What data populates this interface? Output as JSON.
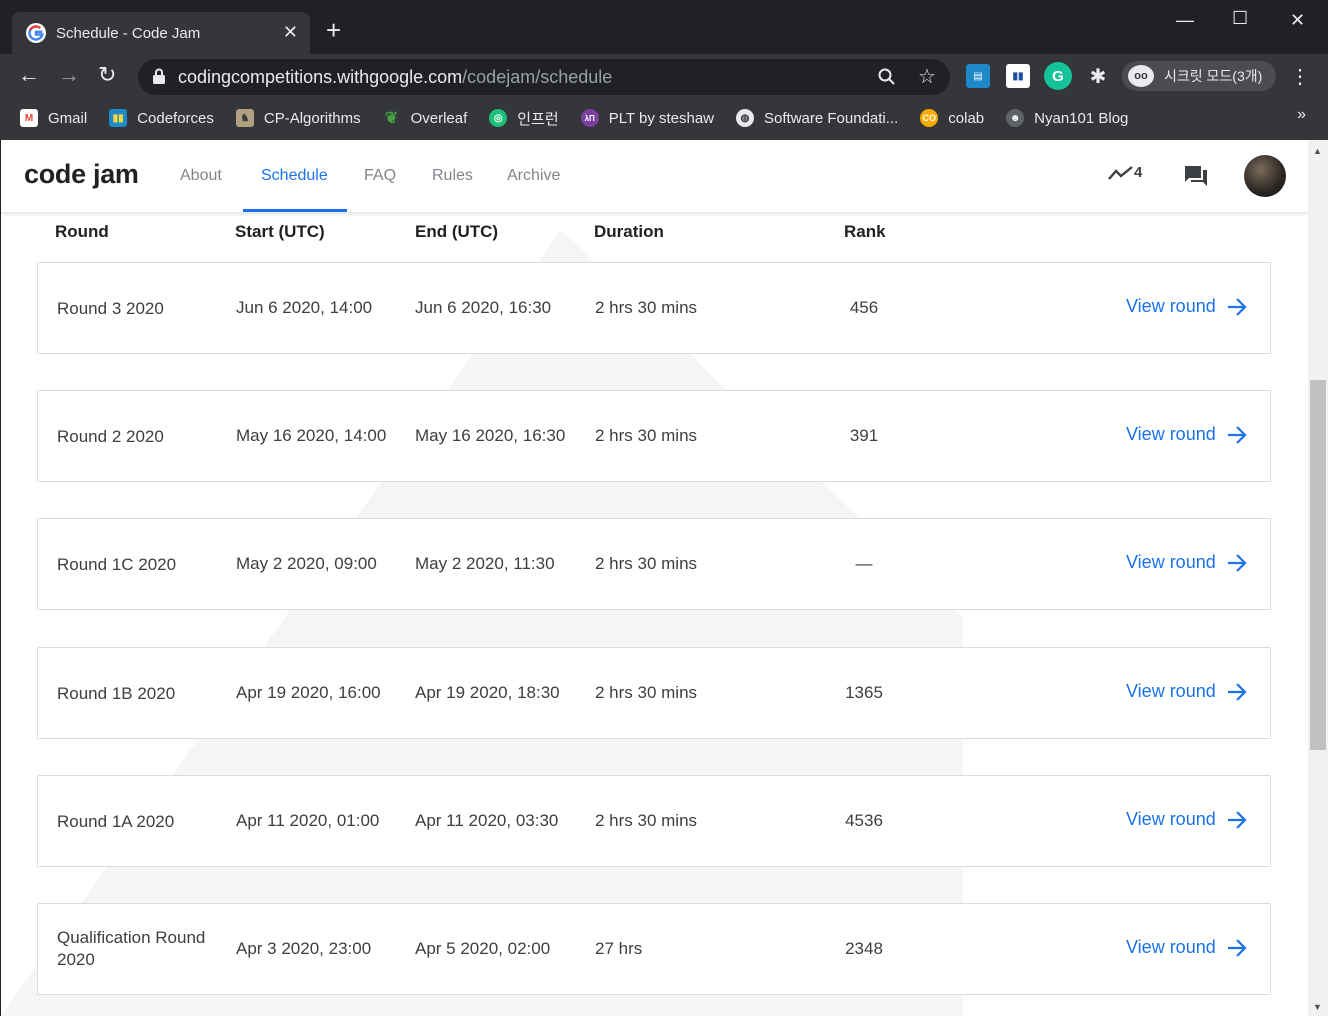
{
  "browser": {
    "tab_title": "Schedule - Code Jam",
    "new_tab": "+",
    "url_host": "codingcompetitions.withgoogle.com",
    "url_path": "/codejam/schedule",
    "incognito_label": "시크릿 모드(3개)",
    "bookmarks": [
      {
        "label": "Gmail",
        "icon": "gmail-icon",
        "color": "#ea4335"
      },
      {
        "label": "Codeforces",
        "icon": "codeforces-icon",
        "color": "#1f8acb"
      },
      {
        "label": "CP-Algorithms",
        "icon": "cp-algorithms-icon",
        "color": "#b0a080"
      },
      {
        "label": "Overleaf",
        "icon": "overleaf-icon",
        "color": "#47a141"
      },
      {
        "label": "인프런",
        "icon": "inflearn-icon",
        "color": "#1dc078"
      },
      {
        "label": "PLT by steshaw",
        "icon": "plt-icon",
        "color": "#7b3fa0"
      },
      {
        "label": "Software Foundati...",
        "icon": "globe-icon",
        "color": "#e8eaed"
      },
      {
        "label": "colab",
        "icon": "colab-icon",
        "color": "#f9ab00"
      },
      {
        "label": "Nyan101 Blog",
        "icon": "nyan-icon",
        "color": "#5f6368"
      }
    ],
    "bookmarks_more": "»"
  },
  "app": {
    "logo": "code jam",
    "nav": [
      "About",
      "Schedule",
      "FAQ",
      "Rules",
      "Archive"
    ],
    "active_nav": "Schedule",
    "trend_count": "4"
  },
  "table": {
    "headers": {
      "round": "Round",
      "start": "Start (UTC)",
      "end": "End (UTC)",
      "duration": "Duration",
      "rank": "Rank"
    },
    "view_label": "View round",
    "rows": [
      {
        "round": "Round 3 2020",
        "start": "Jun 6 2020, 14:00",
        "end": "Jun 6 2020, 16:30",
        "duration": "2 hrs 30 mins",
        "rank": "456"
      },
      {
        "round": "Round 2 2020",
        "start": "May 16 2020, 14:00",
        "end": "May 16 2020, 16:30",
        "duration": "2 hrs 30 mins",
        "rank": "391"
      },
      {
        "round": "Round 1C 2020",
        "start": "May 2 2020, 09:00",
        "end": "May 2 2020, 11:30",
        "duration": "2 hrs 30 mins",
        "rank": "—"
      },
      {
        "round": "Round 1B 2020",
        "start": "Apr 19 2020, 16:00",
        "end": "Apr 19 2020, 18:30",
        "duration": "2 hrs 30 mins",
        "rank": "1365"
      },
      {
        "round": "Round 1A 2020",
        "start": "Apr 11 2020, 01:00",
        "end": "Apr 11 2020, 03:30",
        "duration": "2 hrs 30 mins",
        "rank": "4536"
      },
      {
        "round": "Qualification Round 2020",
        "start": "Apr 3 2020, 23:00",
        "end": "Apr 5 2020, 02:00",
        "duration": "27 hrs",
        "rank": "2348"
      }
    ]
  },
  "colors": {
    "accent": "#1a73e8",
    "chrome_dark": "#202124",
    "chrome_toolbar": "#35363a"
  }
}
